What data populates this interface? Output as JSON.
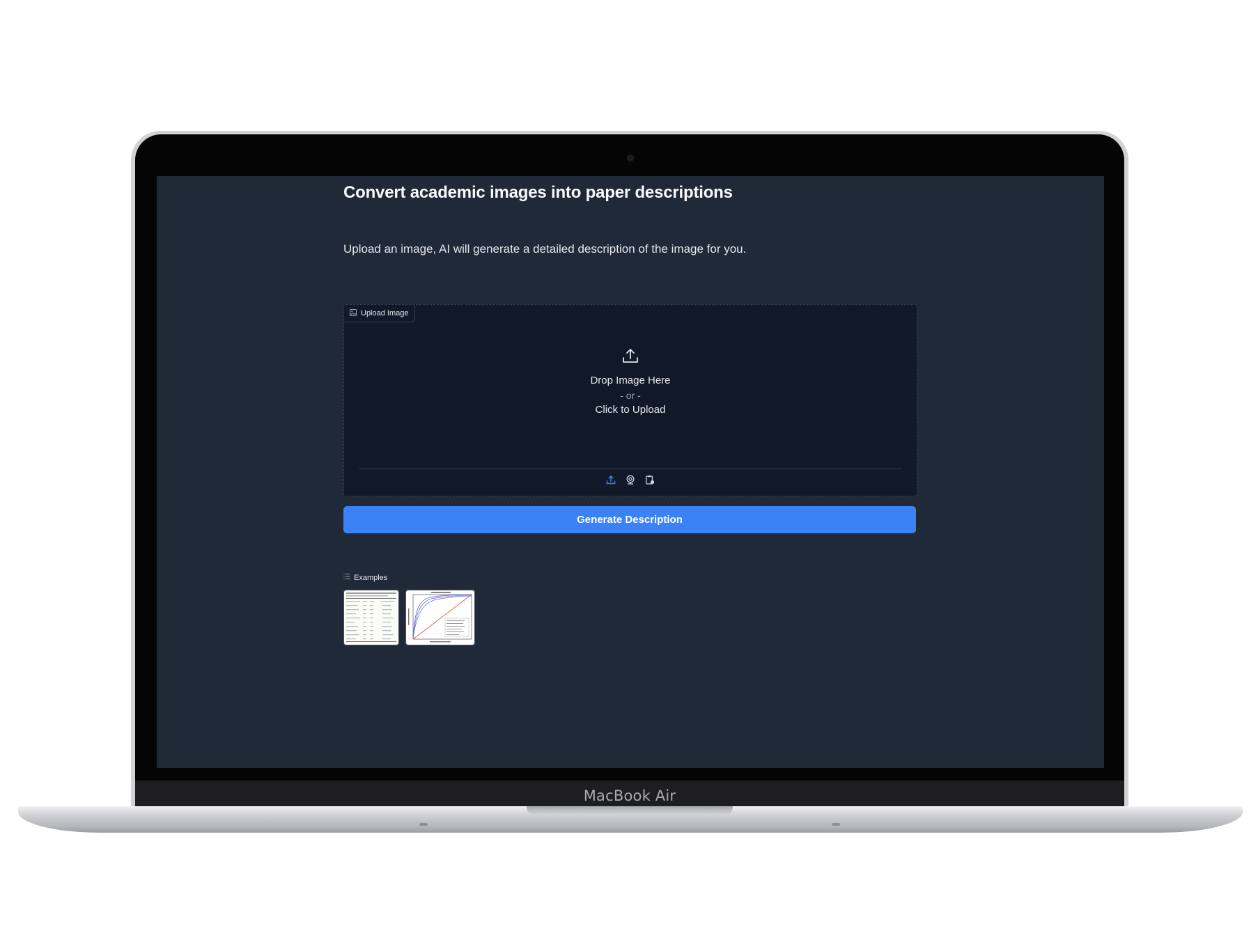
{
  "device": {
    "brand_label": "MacBook Air"
  },
  "page": {
    "title": "Convert academic images into paper descriptions",
    "subtitle": "Upload an image, AI will generate a detailed description of the image for you."
  },
  "upload": {
    "label": "Upload Image",
    "label_icon": "image-icon",
    "drop_text": "Drop Image Here",
    "or_text": "- or -",
    "click_text": "Click to Upload",
    "sources": [
      {
        "icon": "upload-icon",
        "active": true
      },
      {
        "icon": "webcam-icon",
        "active": false
      },
      {
        "icon": "clipboard-icon",
        "active": false
      }
    ]
  },
  "actions": {
    "generate_label": "Generate Description"
  },
  "examples": {
    "label": "Examples",
    "label_icon": "list-icon",
    "items": [
      {
        "kind": "table-image",
        "icon": "table-thumbnail"
      },
      {
        "kind": "roc-chart-image",
        "icon": "chart-thumbnail"
      }
    ]
  },
  "colors": {
    "screen_bg": "#1f2937",
    "panel_bg": "#111827",
    "accent": "#3b82f6",
    "text": "#e5e7eb"
  }
}
